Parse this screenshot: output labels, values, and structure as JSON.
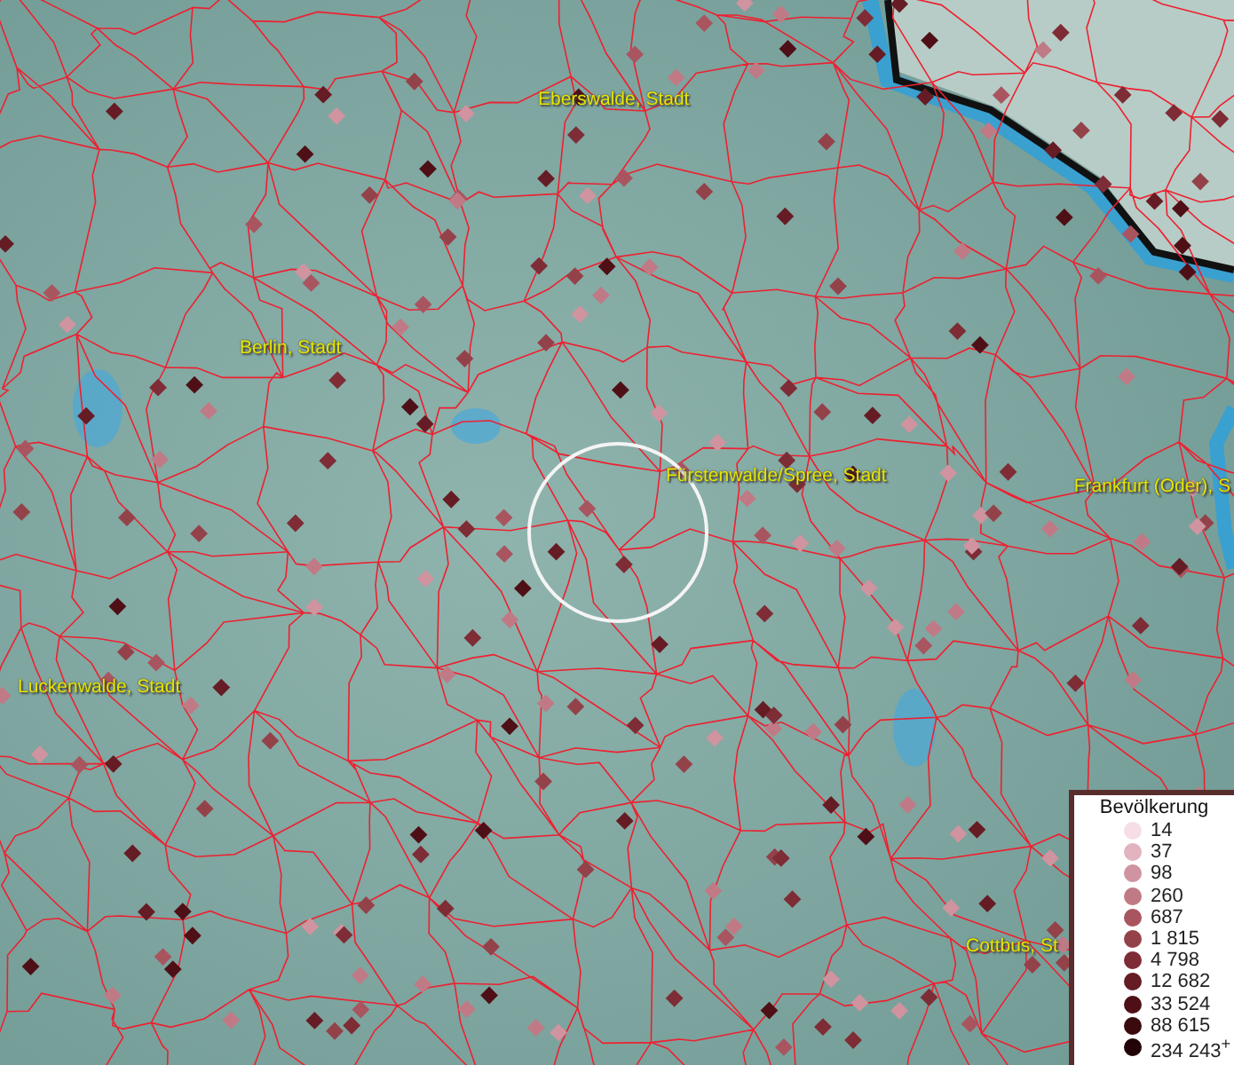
{
  "map": {
    "places": [
      {
        "name": "Eberswalde, Stadt"
      },
      {
        "name": "Berlin, Stadt"
      },
      {
        "name": "Fürstenwalde/Spree, Stadt"
      },
      {
        "name": "Frankfurt (Oder), S"
      },
      {
        "name": "Luckenwalde, Stadt"
      },
      {
        "name": "Cottbus, St"
      }
    ]
  },
  "legend": {
    "title": "Bevölkerung",
    "classes": [
      {
        "label": "14",
        "color": "#f6dde6"
      },
      {
        "label": "37",
        "color": "#e3b3bf"
      },
      {
        "label": "98",
        "color": "#cf949f"
      },
      {
        "label": "260",
        "color": "#c07a85"
      },
      {
        "label": "687",
        "color": "#a95560"
      },
      {
        "label": "1 815",
        "color": "#94424a"
      },
      {
        "label": "4 798",
        "color": "#7e2c35"
      },
      {
        "label": "12 682",
        "color": "#661c24"
      },
      {
        "label": "33 524",
        "color": "#4e1016"
      },
      {
        "label": "88 615",
        "color": "#3a0a0e"
      },
      {
        "label": "234 243$^{+}$",
        "color": "#220406"
      }
    ]
  }
}
